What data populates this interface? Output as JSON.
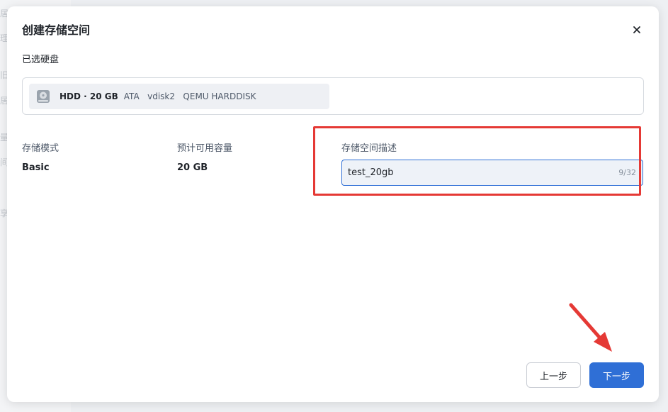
{
  "background": {
    "fragments": [
      "居",
      "理",
      "旧",
      "居",
      "量",
      "间",
      "享"
    ]
  },
  "dialog": {
    "title": "创建存储空间",
    "close_icon": "close-icon",
    "selected_disks_label": "已选硬盘",
    "disk": {
      "icon": "hard-disk-icon",
      "name": "HDD · 20 GB",
      "meta": "ATA   vdisk2   QEMU HARDDISK"
    },
    "storage_mode": {
      "label": "存储模式",
      "value": "Basic"
    },
    "estimated_capacity": {
      "label": "预计可用容量",
      "value": "20 GB"
    },
    "description": {
      "label": "存储空间描述",
      "value": "test_20gb",
      "counter": "9/32"
    },
    "buttons": {
      "prev": "上一步",
      "next": "下一步"
    }
  },
  "colors": {
    "primary": "#2f6fd6",
    "annotation": "#e53935"
  }
}
